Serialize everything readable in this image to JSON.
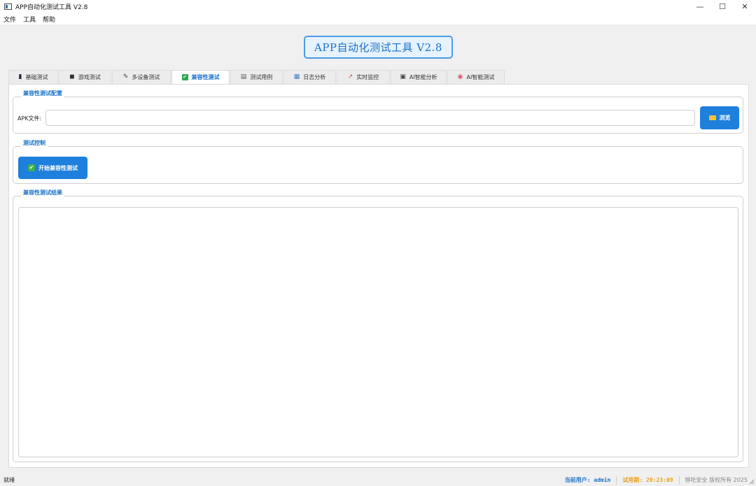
{
  "window": {
    "title": "APP自动化测试工具 V2.8",
    "minimize": "—",
    "maximize": "☐",
    "close": "✕"
  },
  "menu": [
    "文件",
    "工具",
    "帮助"
  ],
  "header": {
    "title": "APP自动化测试工具 V2.8"
  },
  "tabs": [
    {
      "label": "基础测试",
      "icon": "phone-icon",
      "glyph": "▮",
      "color": "#1e2a3a"
    },
    {
      "label": "游戏测试",
      "icon": "gamepad-icon",
      "glyph": "🎮",
      "color": "#333"
    },
    {
      "label": "多设备测试",
      "icon": "pen-icon",
      "glyph": "✎",
      "color": "#444"
    },
    {
      "label": "兼容性测试",
      "icon": "check-icon",
      "glyph": "✔",
      "color": "#2fa84f",
      "active": true
    },
    {
      "label": "测试用例",
      "icon": "clipboard-icon",
      "glyph": "▤",
      "color": "#555"
    },
    {
      "label": "日志分析",
      "icon": "chart-icon",
      "glyph": "▦",
      "color": "#3a7fc0"
    },
    {
      "label": "实时监控",
      "icon": "trend-icon",
      "glyph": "↗",
      "color": "#d9534f"
    },
    {
      "label": "AI智能分析",
      "icon": "robot-icon",
      "glyph": "▣",
      "color": "#444"
    },
    {
      "label": "AI智能测试",
      "icon": "brain-icon",
      "glyph": "◉",
      "color": "#d9536f"
    }
  ],
  "config": {
    "group_title": "兼容性测试配置",
    "apk_label": "APK文件:",
    "apk_value": "",
    "browse_label": "浏览"
  },
  "control": {
    "group_title": "测试控制",
    "start_label": "开始兼容性测试"
  },
  "results": {
    "group_title": "兼容性测试结果",
    "text": ""
  },
  "status": {
    "left": "就绪",
    "user": "当前用户: admin",
    "trial": "试用期: 20:23:09",
    "copyright": "够吃安全 版权所有 2025"
  }
}
